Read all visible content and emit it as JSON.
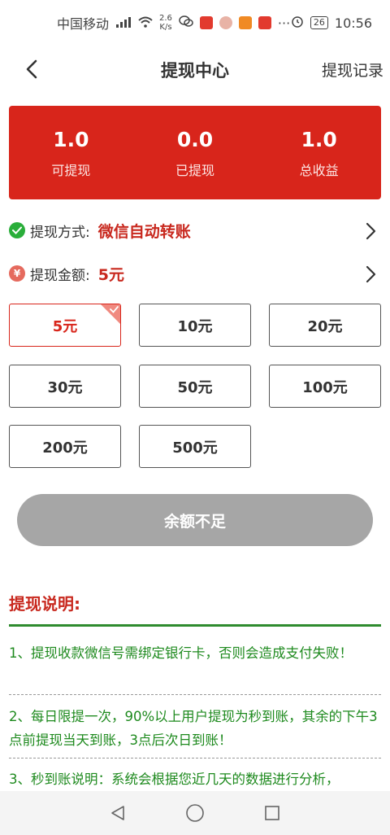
{
  "status_bar": {
    "carrier": "中国移动",
    "network": "4G",
    "speed_value": "2.6",
    "speed_unit": "K/s",
    "battery": "26",
    "time": "10:56"
  },
  "nav": {
    "title": "提现中心",
    "right_link": "提现记录"
  },
  "summary": {
    "items": [
      {
        "value": "1.0",
        "label": "可提现"
      },
      {
        "value": "0.0",
        "label": "已提现"
      },
      {
        "value": "1.0",
        "label": "总收益"
      }
    ]
  },
  "method": {
    "label": "提现方式:",
    "value": "微信自动转账",
    "icon": "wechat-check-icon"
  },
  "amount": {
    "label": "提现金额:",
    "value": "5元",
    "icon": "yen-icon"
  },
  "options": [
    "5元",
    "10元",
    "20元",
    "30元",
    "50元",
    "100元",
    "200元",
    "500元"
  ],
  "selected_index": 0,
  "submit": {
    "label": "余额不足"
  },
  "notes": {
    "title": "提现说明:",
    "items": [
      "1、提现收款微信号需绑定银行卡，否则会造成支付失败！",
      "2、每日限提一次，90%以上用户提现为秒到账，其余的下午3点前提现当天到账，3点后次日到账！",
      "3、秒到账说明：系统会根据您近几天的数据进行分析，"
    ]
  },
  "colors": {
    "primary_red": "#d8251b",
    "note_green": "#1e8a1e",
    "disabled_gray": "#a6a6a6"
  }
}
